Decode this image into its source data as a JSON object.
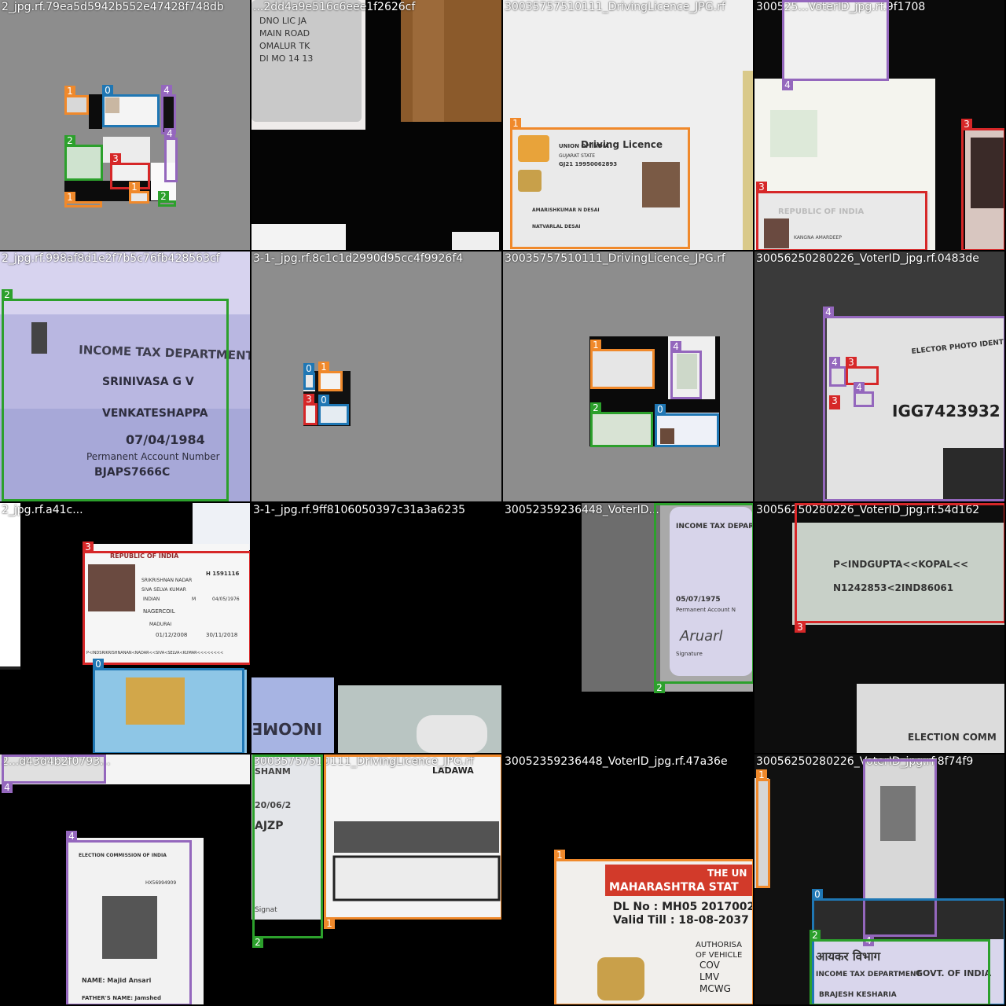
{
  "classes": {
    "0": {
      "color": "#1f77b4"
    },
    "1": {
      "color": "#f0892b"
    },
    "2": {
      "color": "#2ca02c"
    },
    "3": {
      "color": "#d62728"
    },
    "4": {
      "color": "#9467bd"
    }
  },
  "tiles": [
    {
      "title": "2_jpg.rf.79ea5d5942b552e47428f748db",
      "bg": "#8d8d8d",
      "boxes": [
        {
          "cls": "1",
          "label": "1"
        },
        {
          "cls": "0",
          "label": "0"
        },
        {
          "cls": "4",
          "label": "4"
        },
        {
          "cls": "4",
          "label": "4"
        },
        {
          "cls": "2",
          "label": "2"
        },
        {
          "cls": "3",
          "label": "3"
        },
        {
          "cls": "1",
          "label": "1"
        },
        {
          "cls": "1",
          "label": "1"
        },
        {
          "cls": "2",
          "label": "2"
        }
      ]
    },
    {
      "title": "...2dd4a9e516c6eee1f2626cf",
      "bg": "#1a1a1a",
      "boxes": []
    },
    {
      "title": "30035757510111_DrivingLicence_JPG.rf",
      "bg": "#eeeeee",
      "boxes": [
        {
          "cls": "1",
          "label": "1"
        }
      ],
      "doc": {
        "title": "Driving Licence",
        "issuer": "UNION OF INDIA",
        "state": "GUJARAT STATE",
        "number": "GJ21 19950062893",
        "name": "AMARISHKUMAR N DESAI",
        "addr": "NATVARLAL DESAI"
      }
    },
    {
      "title": "300525...VoterID_jpg.rf.9f1708",
      "bg": "#0a0a0a",
      "boxes": [
        {
          "cls": "4",
          "label": "4"
        },
        {
          "cls": "3",
          "label": "3"
        },
        {
          "cls": "3",
          "label": "3"
        }
      ],
      "doc": {
        "title": "REPUBLIC OF INDIA",
        "name": "KANGNA AMARDEEP"
      }
    },
    {
      "title": "2_jpg.rf.998af8d1e2f7b5c76fb428563cf",
      "bg": "#b7b5de",
      "boxes": [
        {
          "cls": "2",
          "label": "2"
        }
      ],
      "doc": {
        "dept": "INCOME TAX DEPARTMENT",
        "name": "SRINIVASA G V",
        "father": "VENKATESHAPPA",
        "dob": "07/04/1984",
        "pan_label": "Permanent Account Number",
        "pan": "BJAPS7666C"
      }
    },
    {
      "title": "3-1-_jpg.rf.8c1c1d2990d95cc4f9926f4",
      "bg": "#8d8d8d",
      "boxes": [
        {
          "cls": "0",
          "label": "0"
        },
        {
          "cls": "1",
          "label": "1"
        },
        {
          "cls": "3",
          "label": "3"
        },
        {
          "cls": "0",
          "label": "0"
        }
      ]
    },
    {
      "title": "30035757510111_DrivingLicence_JPG.rf",
      "bg": "#8d8d8d",
      "boxes": [
        {
          "cls": "1",
          "label": "1"
        },
        {
          "cls": "4",
          "label": "4"
        },
        {
          "cls": "2",
          "label": "2"
        },
        {
          "cls": "0",
          "label": "0"
        }
      ]
    },
    {
      "title": "30056250280226_VoterID_jpg.rf.0483de",
      "bg": "#3a3a3a",
      "boxes": [
        {
          "cls": "4",
          "label": "4"
        },
        {
          "cls": "4",
          "label": "4"
        },
        {
          "cls": "3",
          "label": "3"
        },
        {
          "cls": "3",
          "label": "3"
        },
        {
          "cls": "4",
          "label": "4"
        }
      ],
      "doc": {
        "title": "ELECTOR PHOTO IDENTITY CARD",
        "number": "IGG7423932"
      }
    },
    {
      "title": "2_jpg.rf.a41c...",
      "bg": "#000000",
      "boxes": [
        {
          "cls": "3",
          "label": "3"
        },
        {
          "cls": "0",
          "label": "0"
        }
      ],
      "doc": {
        "title": "REPUBLIC OF INDIA",
        "passport_no": "H 1591116",
        "surname": "SRIKRISHNAN NADAR",
        "given": "SIVA SELVA KUMAR",
        "nationality": "INDIAN",
        "sex": "M",
        "dob": "04/05/1976",
        "pob": "NAGERCOIL",
        "poi": "MADURAI",
        "doi": "01/12/2008",
        "doe": "30/11/2018",
        "mrz": "P<INDSRIKRISHNANAN<NADAR<<SIVA<SELVA<KUMAR<<<<<<<<"
      }
    },
    {
      "title": "3-1-_jpg.rf.9ff8106050397c31a3a6235",
      "bg": "#000000",
      "boxes": [],
      "doc": {
        "dept": "INCOME TA"
      }
    },
    {
      "title": "30052359236448_VoterID...",
      "bg": "#000000",
      "boxes": [
        {
          "cls": "2",
          "label": "2"
        }
      ],
      "doc": {
        "dept": "INCOME TAX DEPAR",
        "dob": "05/07/1975",
        "pan_label": "Permanent Account N",
        "sig": "Signature"
      }
    },
    {
      "title": "30056250280226_VoterID_jpg.rf.54d162",
      "bg": "#0d0d0d",
      "boxes": [
        {
          "cls": "3",
          "label": "3"
        }
      ],
      "doc": {
        "mrz1": "P<INDGUPTA<<KOPAL<<",
        "mrz2": "N1242853<2IND86061",
        "footer": "ELECTION COMM"
      }
    },
    {
      "title": "2...d43d4b2f0793...",
      "bg": "#000000",
      "boxes": [
        {
          "cls": "4",
          "label": "4"
        },
        {
          "cls": "4",
          "label": "4"
        }
      ],
      "doc": {
        "title": "ELECTION COMMISSION OF INDIA",
        "number": "HX56994909",
        "name": "NAME: Majid Ansari",
        "father": "FATHER'S NAME: Jamshed"
      }
    },
    {
      "title": "30035757510111_DrivingLicence_JPG.rf",
      "bg": "#000000",
      "boxes": [
        {
          "cls": "2",
          "label": "2"
        },
        {
          "cls": "1",
          "label": "1"
        }
      ],
      "doc": {
        "name": "SHANM",
        "dob": "20/06/2",
        "pan": "AJZP",
        "sig": "Signat",
        "top": "LADAWA"
      }
    },
    {
      "title": "30052359236448_VoterID_jpg.rf.47a36e",
      "bg": "#000000",
      "boxes": [
        {
          "cls": "1",
          "label": "1"
        }
      ],
      "doc": {
        "state": "MAHARASHTRA STAT",
        "top": "THE UN",
        "dl": "DL No : MH05 2017002",
        "valid": "Valid Till : 18-08-2037 (",
        "auth": "AUTHORISA",
        "veh": "OF VEHICLE",
        "c1": "COV",
        "c2": "LMV",
        "c3": "MCWG"
      }
    },
    {
      "title": "30056250280226_VoterID_jpg.rf.8f74f9",
      "bg": "#111111",
      "boxes": [
        {
          "cls": "1",
          "label": "1"
        },
        {
          "cls": "4",
          "label": "4"
        },
        {
          "cls": "0",
          "label": "0"
        },
        {
          "cls": "2",
          "label": "2"
        }
      ],
      "doc": {
        "dept": "INCOME TAX DEPARTMENT",
        "gov": "GOVT. OF INDIA",
        "name": "BRAJESH KESHARIA"
      }
    }
  ]
}
